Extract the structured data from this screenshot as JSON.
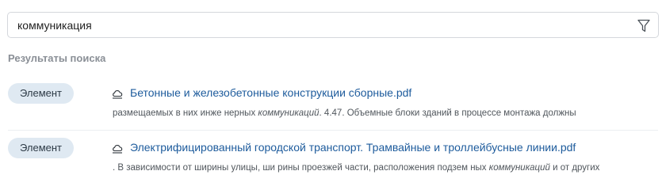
{
  "search": {
    "value": "коммуникация",
    "icon": "filter-icon"
  },
  "results_heading": "Результаты поиска",
  "results": [
    {
      "type_badge": "Элемент",
      "icon": "document-cloud-icon",
      "title": "Бетонные и железобетонные конструкции сборные.pdf",
      "snippet_before": "размещаемых в них инже нерных ",
      "snippet_highlight": "коммуникаций",
      "snippet_after": ". 4.47. Объемные блоки зданий в процессе монтажа должны"
    },
    {
      "type_badge": "Элемент",
      "icon": "document-cloud-icon",
      "title": "Электрифицированный городской транспорт. Трамвайные и троллейбусные линии.pdf",
      "snippet_before": ". В зависимости от ширины улицы, ши рины проезжей части, расположения подзем ных ",
      "snippet_highlight": "коммуникаций",
      "snippet_after": " и от других"
    }
  ],
  "colors": {
    "link": "#1d5b9c",
    "badge_bg": "#dfe9f2",
    "heading": "#8a8f96"
  }
}
